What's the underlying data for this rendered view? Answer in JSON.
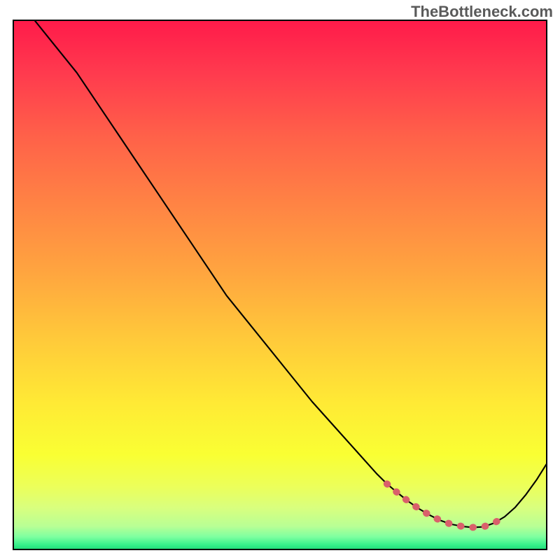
{
  "chart_data": {
    "type": "line",
    "watermark": "TheBottleneck.com",
    "xlim": [
      0,
      100
    ],
    "ylim": [
      0,
      100
    ],
    "xlabel": "",
    "ylabel": "",
    "title": "",
    "curve": {
      "x": [
        4,
        8,
        12,
        16,
        20,
        24,
        28,
        32,
        36,
        40,
        44,
        48,
        52,
        56,
        60,
        64,
        68,
        70,
        72,
        74,
        76,
        78,
        80,
        82,
        84,
        86,
        88,
        90,
        92,
        94,
        96,
        98,
        100
      ],
      "y": [
        100,
        95,
        90,
        84,
        78,
        72,
        66,
        60,
        54,
        48,
        43,
        38,
        33,
        28,
        23.5,
        19,
        14.5,
        12.5,
        10.8,
        9.2,
        7.8,
        6.6,
        5.6,
        4.9,
        4.5,
        4.3,
        4.4,
        5.1,
        6.3,
        8.1,
        10.5,
        13.3,
        16.5
      ]
    },
    "markers": {
      "x": [
        70,
        72,
        74,
        76,
        78,
        80,
        82,
        84,
        86,
        88,
        90,
        92
      ],
      "y": [
        12.5,
        10.8,
        9.2,
        7.8,
        6.6,
        5.6,
        4.9,
        4.5,
        4.3,
        4.4,
        5.1,
        6.3
      ],
      "stroke": "#d9606b",
      "stroke_width": 1.3
    },
    "gradient_stops": [
      {
        "offset": 0.0,
        "color": "#ff1a4a"
      },
      {
        "offset": 0.1,
        "color": "#ff3a4e"
      },
      {
        "offset": 0.22,
        "color": "#ff6149"
      },
      {
        "offset": 0.35,
        "color": "#ff8444"
      },
      {
        "offset": 0.48,
        "color": "#ffa63f"
      },
      {
        "offset": 0.6,
        "color": "#ffc93a"
      },
      {
        "offset": 0.72,
        "color": "#ffe935"
      },
      {
        "offset": 0.82,
        "color": "#f9ff33"
      },
      {
        "offset": 0.88,
        "color": "#ecff5a"
      },
      {
        "offset": 0.92,
        "color": "#d9ff7e"
      },
      {
        "offset": 0.955,
        "color": "#b8ff95"
      },
      {
        "offset": 0.975,
        "color": "#7dffa0"
      },
      {
        "offset": 0.99,
        "color": "#35f08a"
      },
      {
        "offset": 1.0,
        "color": "#1fd677"
      }
    ]
  }
}
